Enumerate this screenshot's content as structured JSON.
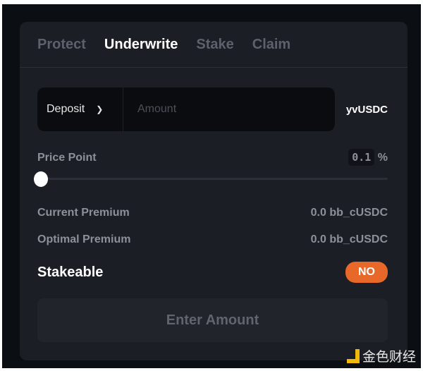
{
  "tabs": [
    {
      "label": "Protect"
    },
    {
      "label": "Underwrite",
      "active": true
    },
    {
      "label": "Stake"
    },
    {
      "label": "Claim"
    }
  ],
  "deposit": {
    "mode": "Deposit",
    "amount_placeholder": "Amount",
    "amount_value": "",
    "token": "yvUSDC"
  },
  "price_point": {
    "label": "Price Point",
    "value": "0.1",
    "unit": "%",
    "slider_fraction": 0.0
  },
  "current_premium": {
    "label": "Current Premium",
    "value": "0.0 bb_cUSDC"
  },
  "optimal_premium": {
    "label": "Optimal Premium",
    "value": "0.0 bb_cUSDC"
  },
  "stakeable": {
    "label": "Stakeable",
    "value": "NO"
  },
  "submit": {
    "label": "Enter Amount"
  },
  "colors": {
    "accent": "#e8682a",
    "background": "#1b1e25"
  },
  "watermark": {
    "text": "金色财经"
  }
}
